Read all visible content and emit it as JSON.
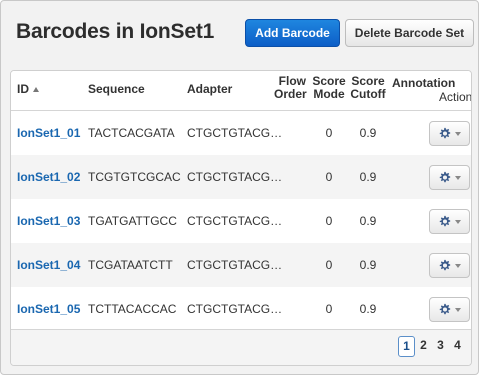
{
  "header": {
    "title": "Barcodes in IonSet1",
    "add_button": "Add Barcode",
    "delete_button": "Delete Barcode Set"
  },
  "table": {
    "columns": {
      "id": "ID",
      "sequence": "Sequence",
      "adapter": "Adapter",
      "flow_order_line1": "Flow",
      "flow_order_line2": "Order",
      "score_mode_line1": "Score",
      "score_mode_line2": "Mode",
      "score_cutoff_line1": "Score",
      "score_cutoff_line2": "Cutoff",
      "annotation": "Annotation",
      "action": "Action"
    },
    "sort": {
      "column": "ID",
      "direction": "ascending"
    },
    "rows": [
      {
        "id": "IonSet1_01",
        "sequence": "TACTCACGATA",
        "adapter": "CTGCTGTACGG...",
        "flow_order": "",
        "score_mode": "0",
        "score_cutoff": "0.9"
      },
      {
        "id": "IonSet1_02",
        "sequence": "TCGTGTCGCAC",
        "adapter": "CTGCTGTACGG...",
        "flow_order": "",
        "score_mode": "0",
        "score_cutoff": "0.9"
      },
      {
        "id": "IonSet1_03",
        "sequence": "TGATGATTGCC",
        "adapter": "CTGCTGTACGG...",
        "flow_order": "",
        "score_mode": "0",
        "score_cutoff": "0.9"
      },
      {
        "id": "IonSet1_04",
        "sequence": "TCGATAATCTT",
        "adapter": "CTGCTGTACGG...",
        "flow_order": "",
        "score_mode": "0",
        "score_cutoff": "0.9"
      },
      {
        "id": "IonSet1_05",
        "sequence": "TCTTACACCAC",
        "adapter": "CTGCTGTACGG...",
        "flow_order": "",
        "score_mode": "0",
        "score_cutoff": "0.9"
      }
    ],
    "row_action_icon": "gear-icon",
    "row_action_caret_icon": "caret-down-icon"
  },
  "pagination": {
    "pages": [
      "1",
      "2",
      "3",
      "4"
    ],
    "current": "1"
  },
  "colors": {
    "primary_button": "#0c5ec7",
    "link": "#1a67b0",
    "active_page_border": "#5b8fc9"
  }
}
